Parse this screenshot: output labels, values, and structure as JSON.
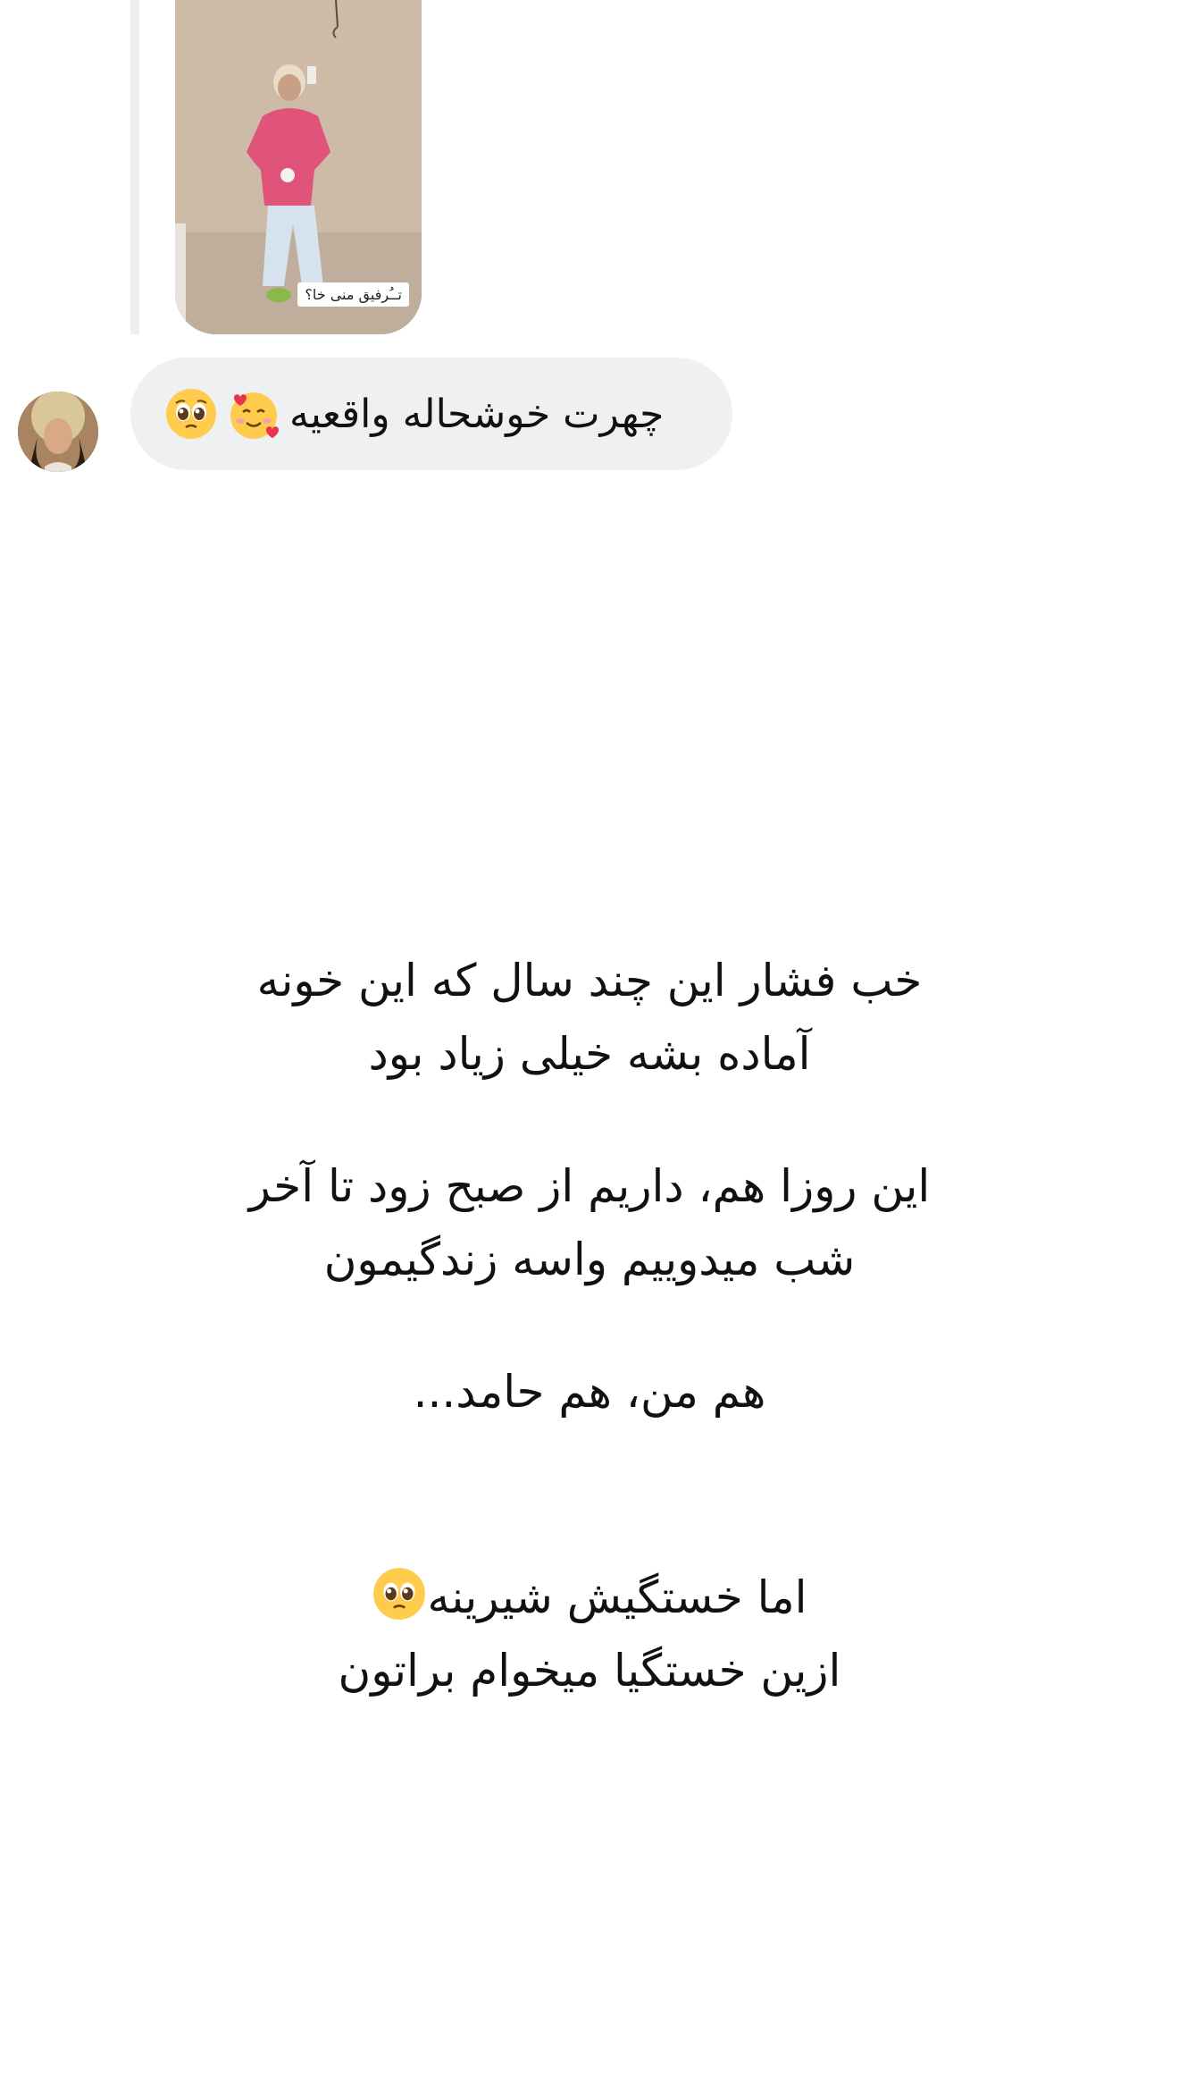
{
  "story_reply": {
    "caption": "تــُرفیق منی خا؟"
  },
  "message": {
    "text": "چهرت خوشحاله واقعیه",
    "emojis": [
      "smiling-face-with-hearts-emoji",
      "pleading-face-emoji"
    ]
  },
  "story_text": {
    "para1": {
      "line1": "خب فشار این چند سال که این خونه",
      "line2": "آماده بشه خیلی زیاد بود"
    },
    "para2": {
      "line1": "این روزا هم، داریم از صبح زود تا آخر",
      "line2": "شب میدوییم واسه زندگیمون"
    },
    "para3": {
      "line1": "هم من، هم حامد..."
    },
    "para4": {
      "line1": "اما خستگیش شیرینه",
      "line2": "ازین خستگیا میخوام براتون"
    }
  },
  "colors": {
    "bubble_bg": "#eff0f2",
    "reply_line": "#eceef0",
    "text": "#111111"
  }
}
